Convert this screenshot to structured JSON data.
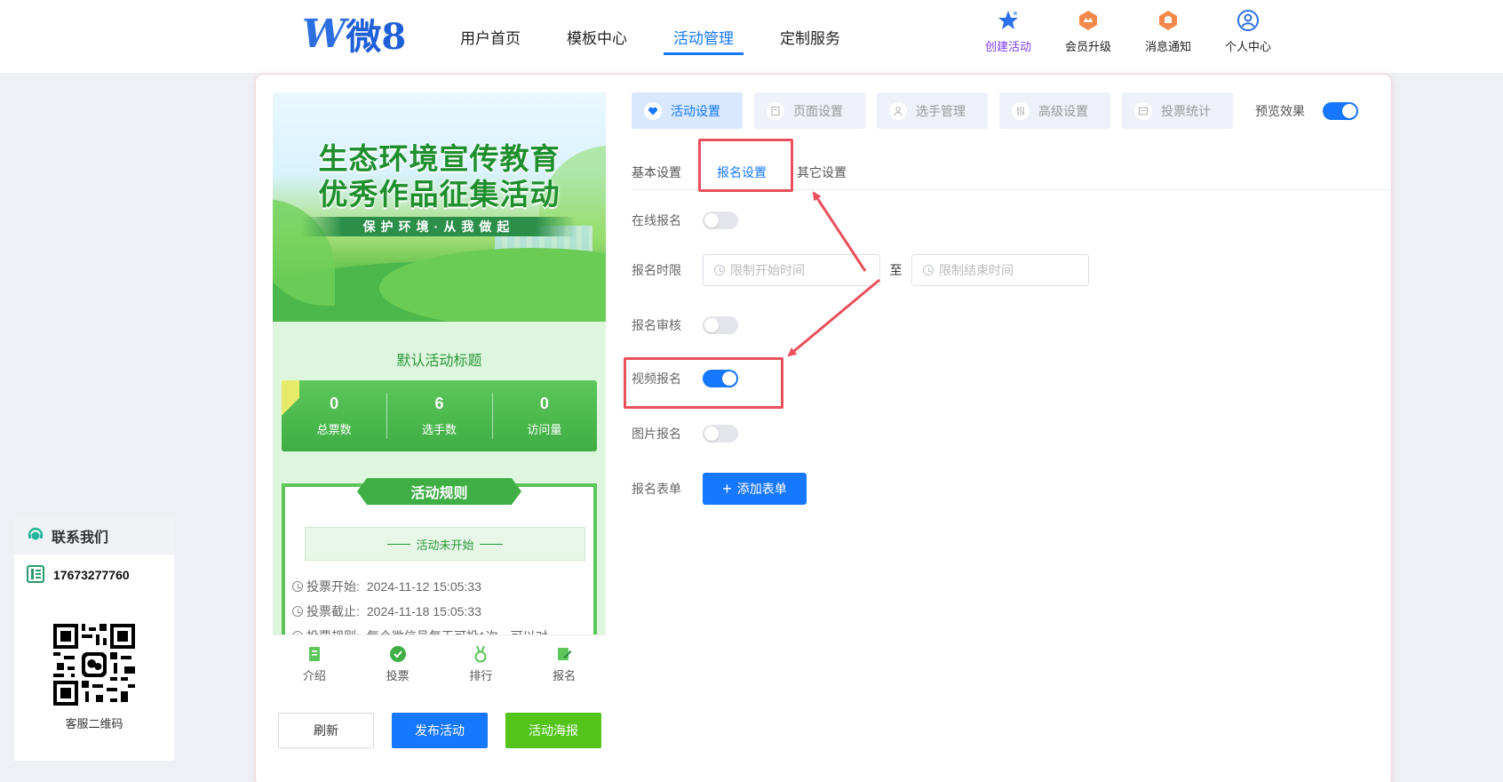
{
  "header": {
    "logo_letter": "W",
    "logo_text": "微8",
    "nav": [
      {
        "label": "用户首页"
      },
      {
        "label": "模板中心"
      },
      {
        "label": "活动管理",
        "active": true
      },
      {
        "label": "定制服务"
      }
    ],
    "tools": [
      {
        "label": "创建活动",
        "icon": "star-icon"
      },
      {
        "label": "会员升级",
        "icon": "crown-icon"
      },
      {
        "label": "消息通知",
        "icon": "bell-icon"
      },
      {
        "label": "个人中心",
        "icon": "user-icon"
      }
    ]
  },
  "contact": {
    "title": "联系我们",
    "phone": "17673277760",
    "qr_label": "客服二维码"
  },
  "preview": {
    "banner_line1": "生态环境宣传教育",
    "banner_line2": "优秀作品征集活动",
    "banner_sub": "保护环境·从我做起",
    "activity_title": "默认活动标题",
    "stats": [
      {
        "value": "0",
        "label": "总票数"
      },
      {
        "value": "6",
        "label": "选手数"
      },
      {
        "value": "0",
        "label": "访问量"
      }
    ],
    "rules_title": "活动规则",
    "status": "活动未开始",
    "vote_start_label": "投票开始:",
    "vote_start": "2024-11-12 15:05:33",
    "vote_end_label": "投票截止:",
    "vote_end": "2024-11-18 15:05:33",
    "vote_rule_label": "投票规则:",
    "vote_rule": "每个微信号每天可投1次，可以对",
    "tabbar": [
      {
        "label": "介绍",
        "icon": "doc-icon"
      },
      {
        "label": "投票",
        "icon": "vote-icon"
      },
      {
        "label": "排行",
        "icon": "medal-icon"
      },
      {
        "label": "报名",
        "icon": "edit-icon"
      }
    ],
    "buttons": {
      "refresh": "刷新",
      "publish": "发布活动",
      "poster": "活动海报"
    }
  },
  "settings": {
    "top_tabs": [
      {
        "label": "活动设置",
        "active": true
      },
      {
        "label": "页面设置"
      },
      {
        "label": "选手管理"
      },
      {
        "label": "高级设置"
      },
      {
        "label": "投票统计"
      }
    ],
    "preview_label": "预览效果",
    "preview_on": true,
    "sub_tabs": [
      {
        "label": "基本设置"
      },
      {
        "label": "报名设置",
        "active": true
      },
      {
        "label": "其它设置"
      }
    ],
    "rows": {
      "online": {
        "label": "在线报名",
        "on": false
      },
      "period": {
        "label": "报名时限",
        "start_placeholder": "限制开始时间",
        "sep": "至",
        "end_placeholder": "限制结束时间"
      },
      "review": {
        "label": "报名审核",
        "on": false
      },
      "video": {
        "label": "视频报名",
        "on": true
      },
      "image": {
        "label": "图片报名",
        "on": false
      },
      "form": {
        "label": "报名表单",
        "add_label": "添加表单"
      }
    }
  },
  "colors": {
    "primary": "#1677ff",
    "highlight": "#e8505b",
    "green": "#3fae45"
  }
}
